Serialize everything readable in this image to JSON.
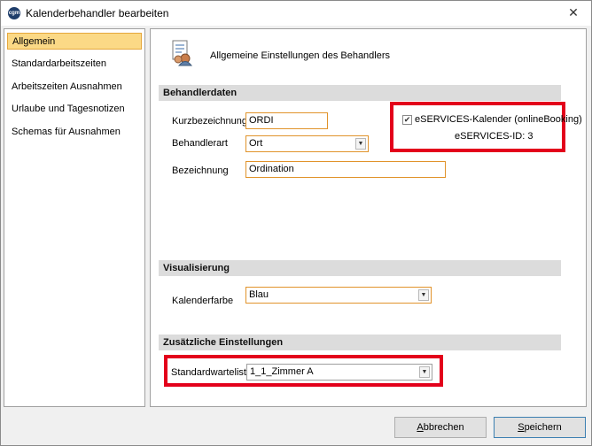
{
  "window": {
    "title": "Kalenderbehandler bearbeiten",
    "app_icon_text": "cgm",
    "close_glyph": "✕"
  },
  "nav": {
    "items": [
      {
        "label": "Allgemein",
        "active": true
      },
      {
        "label": "Standardarbeitszeiten",
        "active": false
      },
      {
        "label": "Arbeitszeiten Ausnahmen",
        "active": false
      },
      {
        "label": "Urlaube und Tagesnotizen",
        "active": false
      },
      {
        "label": "Schemas für Ausnahmen",
        "active": false
      }
    ]
  },
  "header": {
    "icon": "settings-document-icon",
    "text": "Allgemeine Einstellungen des Behandlers"
  },
  "sections": {
    "behandlerdaten": {
      "title": "Behandlerdaten",
      "kurzbezeichnung_label": "Kurzbezeichnung",
      "kurzbezeichnung_value": "ORDI",
      "behandlerart_label": "Behandlerart",
      "behandlerart_value": "Ort",
      "bezeichnung_label": "Bezeichnung",
      "bezeichnung_value": "Ordination",
      "eservices_label": "eSERVICES-Kalender (onlineBooking)",
      "eservices_checked": true,
      "eservices_check_glyph": "✔",
      "eservices_id": "eSERVICES-ID: 3"
    },
    "visualisierung": {
      "title": "Visualisierung",
      "kalenderfarbe_label": "Kalenderfarbe",
      "kalenderfarbe_value": "Blau"
    },
    "zusaetzliche": {
      "title": "Zusätzliche Einstellungen",
      "standardwarteliste_label": "Standardwarteliste",
      "standardwarteliste_value": "1_1_Zimmer A"
    }
  },
  "dropdown_glyph": "▼",
  "buttons": {
    "abbrechen_first": "A",
    "abbrechen_rest": "bbrechen",
    "speichern_first": "S",
    "speichern_rest": "peichern"
  },
  "colors": {
    "highlight_red": "#e3001b",
    "field_border_orange": "#e1932b",
    "nav_active_bg": "#fbd986"
  }
}
